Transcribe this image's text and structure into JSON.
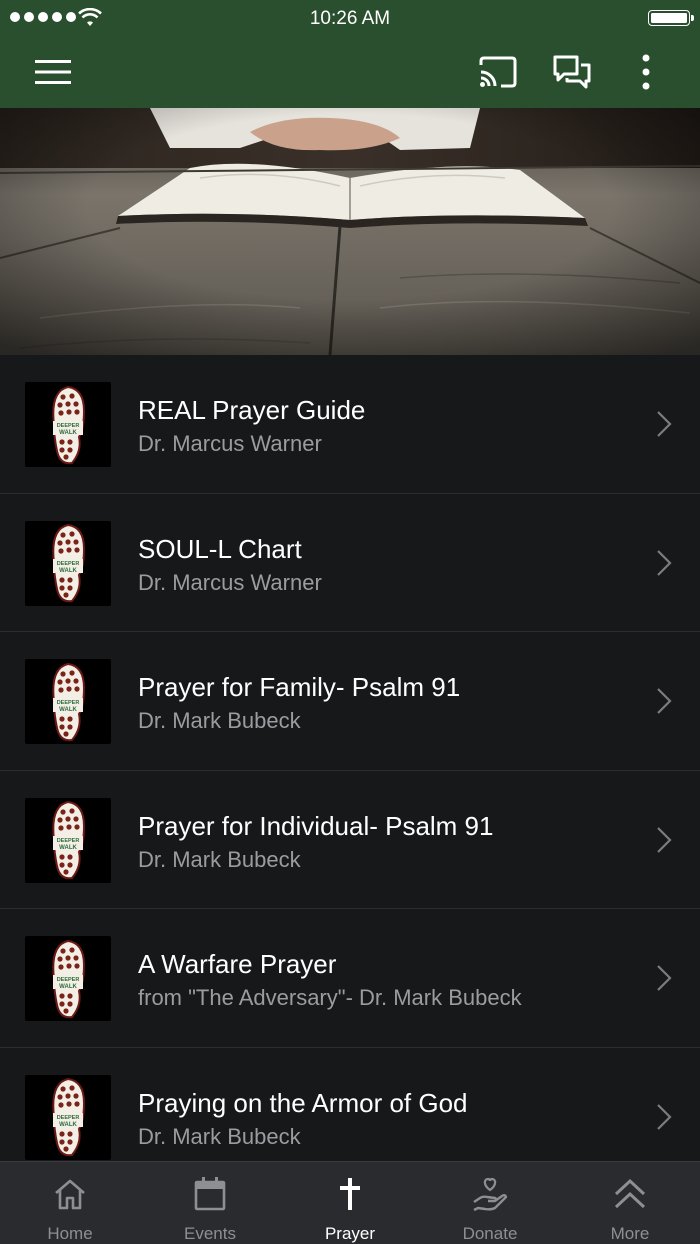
{
  "status_bar": {
    "time": "10:26 AM"
  },
  "app_bar": {
    "menu_icon": "hamburger-icon",
    "cast_icon": "cast-icon",
    "chat_icon": "chat-icon",
    "more_icon": "vertical-dots-icon"
  },
  "hero": {
    "image": "open-bible-on-wooden-table"
  },
  "items": [
    {
      "title": "REAL Prayer Guide",
      "subtitle": "Dr. Marcus Warner"
    },
    {
      "title": "SOUL-L Chart",
      "subtitle": "Dr. Marcus Warner"
    },
    {
      "title": "Prayer for Family- Psalm 91",
      "subtitle": "Dr. Mark Bubeck"
    },
    {
      "title": "Prayer for Individual- Psalm 91",
      "subtitle": "Dr. Mark Bubeck"
    },
    {
      "title": "A Warfare Prayer",
      "subtitle": "from \"The Adversary\"- Dr. Mark Bubeck"
    },
    {
      "title": "Praying on the Armor of God",
      "subtitle": "Dr. Mark Bubeck"
    }
  ],
  "tabs": [
    {
      "label": "Home",
      "icon": "home-icon"
    },
    {
      "label": "Events",
      "icon": "calendar-icon"
    },
    {
      "label": "Prayer",
      "icon": "cross-icon",
      "active": true
    },
    {
      "label": "Donate",
      "icon": "donate-hand-heart-icon"
    },
    {
      "label": "More",
      "icon": "double-chevron-up-icon"
    }
  ],
  "colors": {
    "header": "#2a4f2e",
    "list_bg": "#17181a",
    "tab_bar": "#2a2b2e",
    "subtitle": "#9a9ca0"
  }
}
